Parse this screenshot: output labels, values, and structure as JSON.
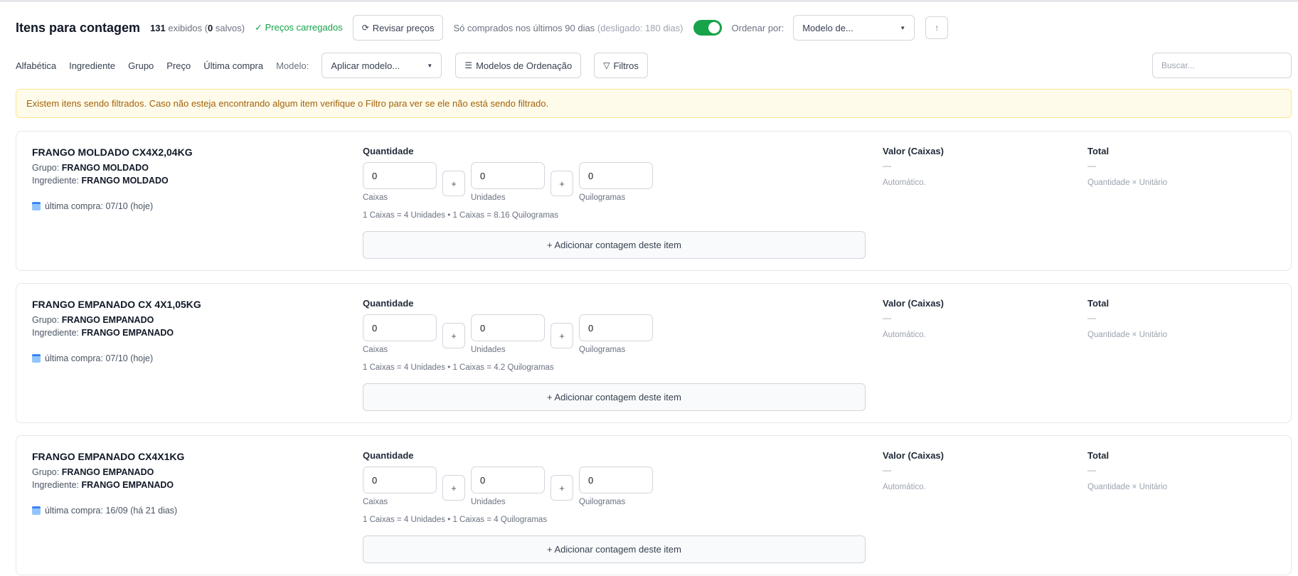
{
  "header": {
    "title": "Itens para contagem",
    "shown_count": "131",
    "shown_text": "exibidos (",
    "saved_count": "0",
    "saved_text": "salvos)",
    "prices_status": "✓ Preços carregados",
    "review_prices": "Revisar preços",
    "recent_filter": "Só comprados nos últimos 90 dias",
    "recent_filter_off": "(desligado: 180 dias)",
    "toggle_on": true,
    "order_by_label": "Ordenar por:",
    "order_by_value": "Modelo de...",
    "order_dir_icon": "↑"
  },
  "toolbar": {
    "sort_links": [
      "Alfabética",
      "Ingrediente",
      "Grupo",
      "Preço",
      "Última compra"
    ],
    "model_label": "Modelo:",
    "model_select": "Aplicar modelo...",
    "sort_models": "Modelos de Ordenação",
    "filters": "Filtros",
    "search_placeholder": "Buscar..."
  },
  "alert": {
    "text": "Existem itens sendo filtrados. Caso não esteja encontrando algum item verifique o Filtro para ver se ele não está sendo filtrado."
  },
  "labels": {
    "quantity": "Quantidade",
    "group": "Grupo:",
    "ingredient": "Ingrediente:",
    "plus": "+",
    "boxes": "Caixas",
    "units": "Unidades",
    "kilos": "Quilogramas",
    "add_count": "+ Adicionar contagem deste item",
    "value_header": "Valor (Caixas)",
    "total_header": "Total",
    "dash": "—",
    "auto": "Automático.",
    "formula": "Quantidade × Unitário"
  },
  "items": [
    {
      "name": "FRANGO MOLDADO CX4X2,04KG",
      "group": "FRANGO MOLDADO",
      "ingredient": "FRANGO MOLDADO",
      "last_purchase": "última compra: 07/10 (hoje)",
      "boxes": "0",
      "units": "0",
      "kilos": "0",
      "conversion": "1 Caixas = 4 Unidades • 1 Caixas = 8.16 Quilogramas"
    },
    {
      "name": "FRANGO EMPANADO CX 4X1,05KG",
      "group": "FRANGO EMPANADO",
      "ingredient": "FRANGO EMPANADO",
      "last_purchase": "última compra: 07/10 (hoje)",
      "boxes": "0",
      "units": "0",
      "kilos": "0",
      "conversion": "1 Caixas = 4 Unidades • 1 Caixas = 4.2 Quilogramas"
    },
    {
      "name": "FRANGO EMPANADO CX4X1KG",
      "group": "FRANGO EMPANADO",
      "ingredient": "FRANGO EMPANADO",
      "last_purchase": "última compra: 16/09 (há 21 dias)",
      "boxes": "0",
      "units": "0",
      "kilos": "0",
      "conversion": "1 Caixas = 4 Unidades • 1 Caixas = 4 Quilogramas"
    }
  ]
}
